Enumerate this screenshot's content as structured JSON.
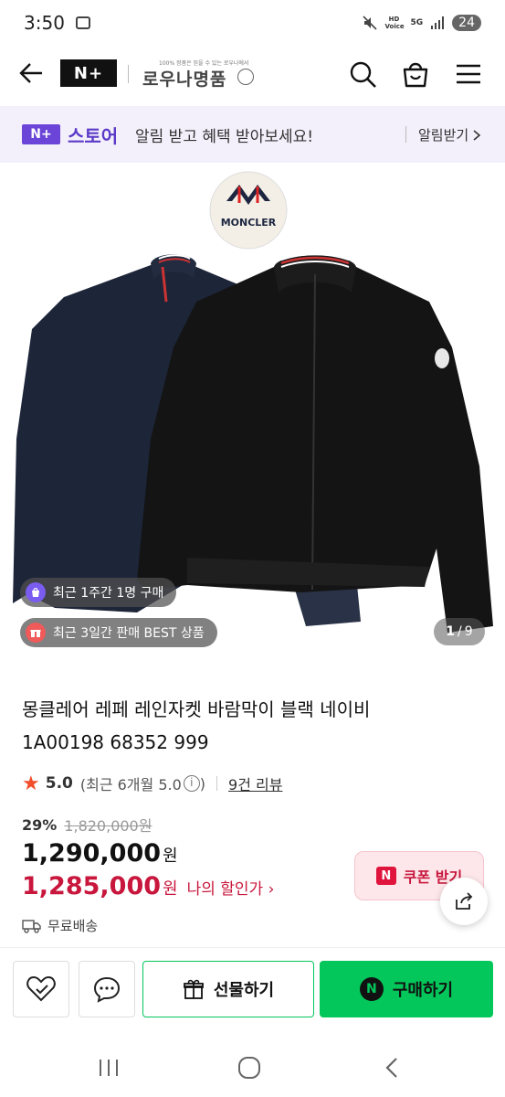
{
  "status_bar": {
    "time": "3:50",
    "badges": [
      "HD Voice",
      "5G"
    ],
    "battery": "24"
  },
  "nav": {
    "logo_text": "N+",
    "store_name": "로우나명품",
    "store_tagline": "100% 정품은 믿을 수 있는 로우나에서"
  },
  "promo": {
    "logo_text": "N+",
    "store_label": "스토어",
    "message": "알림 받고 혜택 받아보세요!",
    "action_label": "알림받기"
  },
  "gallery": {
    "badges": [
      {
        "text": "최근 1주간 1명 구매",
        "color": "#7b5cf0"
      },
      {
        "text": "최근 3일간 판매 BEST 상품",
        "color": "#f05a5a"
      }
    ],
    "pager_current": "1",
    "pager_separator": "/",
    "pager_total": "9",
    "brand_logo_text": "MONCLER"
  },
  "product": {
    "title_line1": "몽클레어 레페 레인자켓 바람막이 블랙 네이비",
    "title_line2": "1A00198 68352 999",
    "rating": "5.0",
    "rating_note": "(최근 6개월 5.0",
    "rating_note_close": ")",
    "review_link": "9건 리뷰",
    "discount_rate": "29%",
    "original_price": "1,820,000원",
    "price": "1,290,000",
    "price_unit": "원",
    "sale_price": "1,285,000",
    "sale_unit": "원",
    "sale_link": "나의 할인가 ›",
    "coupon_label": "쿠폰 받기",
    "shipping": "무료배송"
  },
  "actions": {
    "gift_label": "선물하기",
    "buy_label": "구매하기"
  },
  "colors": {
    "naver_green": "#03c75a",
    "sale_red": "#c8163c",
    "promo_purple": "#6b45d8",
    "jacket_navy": "#1d2538",
    "jacket_black": "#141414"
  }
}
